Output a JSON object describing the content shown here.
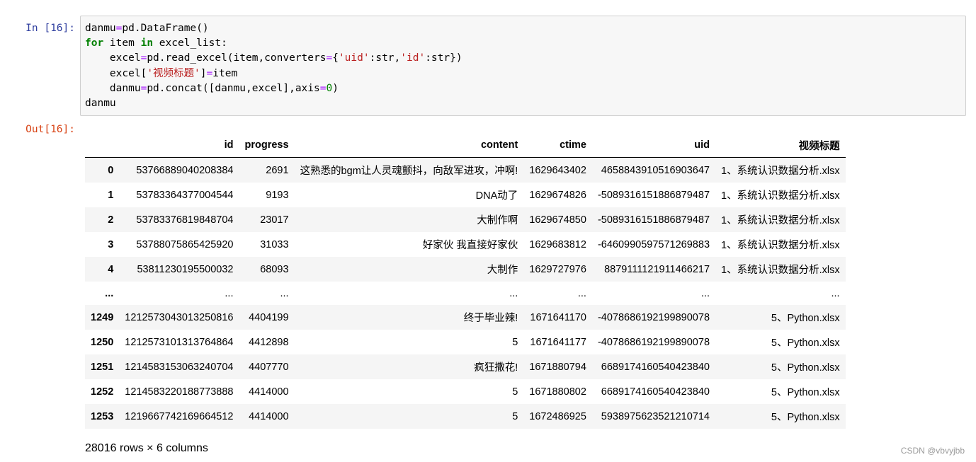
{
  "cell": {
    "in_prompt": "In  [16]:",
    "out_prompt": "Out[16]:"
  },
  "dataframe": {
    "columns": [
      "",
      "id",
      "progress",
      "content",
      "ctime",
      "uid",
      "视频标题"
    ],
    "rows": [
      [
        "0",
        "53766889040208384",
        "2691",
        "这熟悉的bgm让人灵魂颤抖，向敌军进攻，冲啊!",
        "1629643402",
        "465884391051690364​7",
        "1、系统认识数据分析.xlsx"
      ],
      [
        "1",
        "53783364377004544",
        "9193",
        "DNA动了",
        "1629674826",
        "-5089316151886879487",
        "1、系统认识数据分析.xlsx"
      ],
      [
        "2",
        "53783376819848704",
        "23017",
        "大制作啊",
        "1629674850",
        "-5089316151886879487",
        "1、系统认识数据分析.xlsx"
      ],
      [
        "3",
        "53788075865425920",
        "31033",
        "好家伙 我直接好家伙",
        "1629683812",
        "-6460990597571269883",
        "1、系统认识数据分析.xlsx"
      ],
      [
        "4",
        "53811230195500032",
        "68093",
        "大制作",
        "1629727976",
        "8879111121911466217",
        "1、系统认识数据分析.xlsx"
      ],
      [
        "...",
        "...",
        "...",
        "...",
        "...",
        "...",
        "..."
      ],
      [
        "1249",
        "1212573043013250816",
        "4404199",
        "终于毕业辣!",
        "1671641170",
        "-4078686192199890078",
        "5、Python.xlsx"
      ],
      [
        "1250",
        "1212573101313764864",
        "4412898",
        "5",
        "1671641177",
        "-4078686192199890078",
        "5、Python.xlsx"
      ],
      [
        "1251",
        "1214583153063240704",
        "4407770",
        "疯狂撒花!",
        "1671880794",
        "6689174160540423840",
        "5、Python.xlsx"
      ],
      [
        "1252",
        "1214583220188773888",
        "4414000",
        "5",
        "1671880802",
        "6689174160540423840",
        "5、Python.xlsx"
      ],
      [
        "1253",
        "1219667742169664512",
        "4414000",
        "5",
        "1672486925",
        "5938975623521210714",
        "5、Python.xlsx"
      ]
    ],
    "shape_text": "28016 rows × 6 columns"
  },
  "watermark": "CSDN @vbvyjbb"
}
